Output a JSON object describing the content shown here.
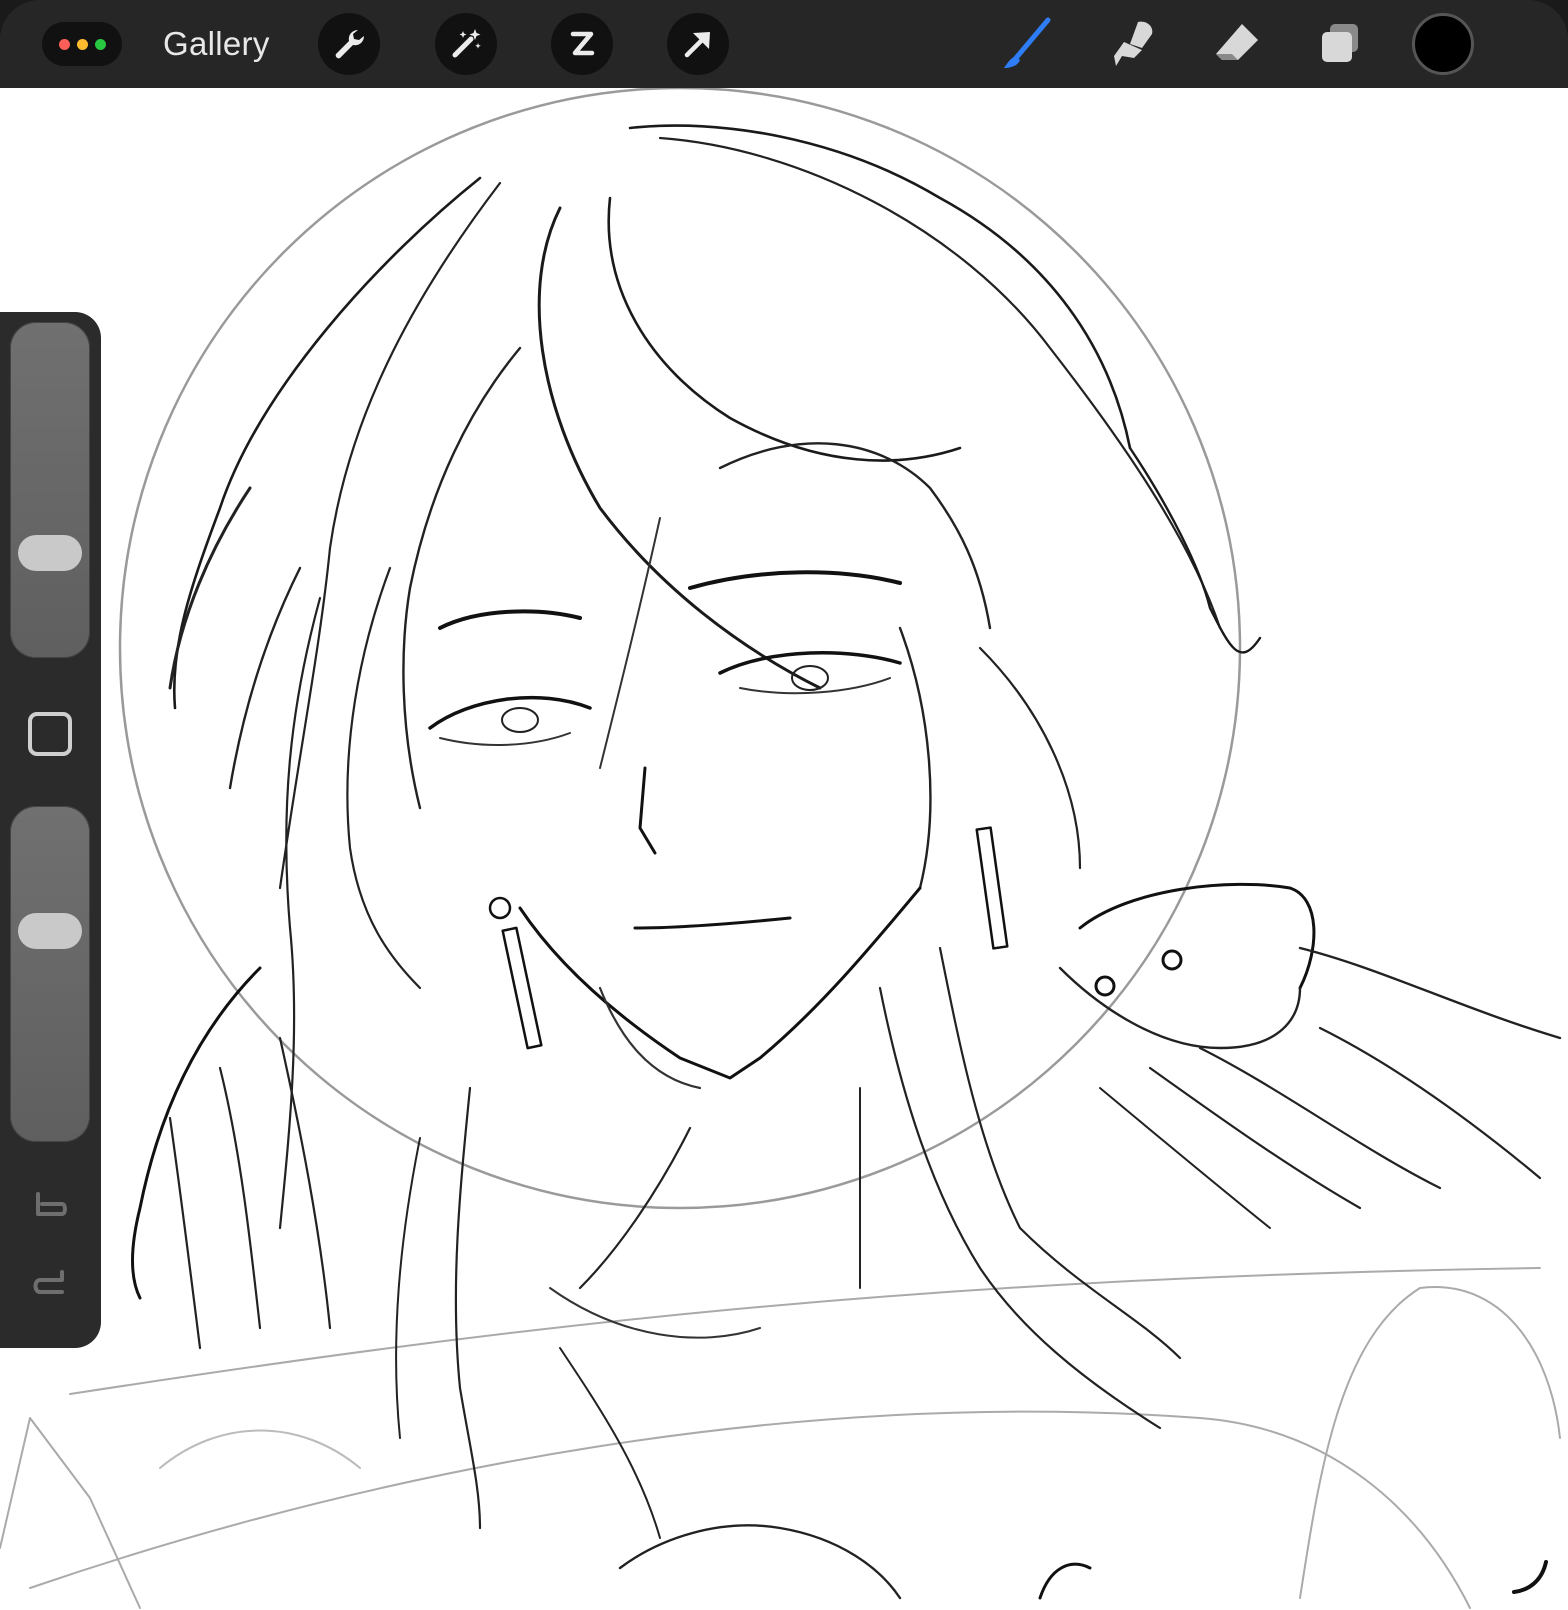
{
  "window": {
    "traffic_lights": [
      "#ff5f57",
      "#febc2e",
      "#28c840"
    ]
  },
  "toolbar": {
    "gallery_label": "Gallery",
    "left_tools": [
      {
        "name": "actions",
        "icon": "wrench-icon"
      },
      {
        "name": "adjustments",
        "icon": "magic-wand-icon"
      },
      {
        "name": "selection",
        "icon": "selection-s-icon"
      },
      {
        "name": "transform",
        "icon": "arrow-cursor-icon"
      }
    ],
    "right_tools": [
      {
        "name": "brush",
        "icon": "brush-icon",
        "active": true
      },
      {
        "name": "smudge",
        "icon": "smudge-icon",
        "active": false
      },
      {
        "name": "eraser",
        "icon": "eraser-icon",
        "active": false
      },
      {
        "name": "layers",
        "icon": "layers-icon",
        "active": false
      }
    ],
    "current_color": "#000000",
    "active_tool_color": "#2f7df6"
  },
  "sidebar": {
    "brush_size_level": 0.28,
    "opacity_level": 0.65,
    "modify_button_icon": "square-icon",
    "undo_icon": "undo-icon",
    "redo_icon": "redo-icon"
  },
  "canvas": {
    "background": "#ffffff",
    "artwork": "line-sketch-icon"
  }
}
